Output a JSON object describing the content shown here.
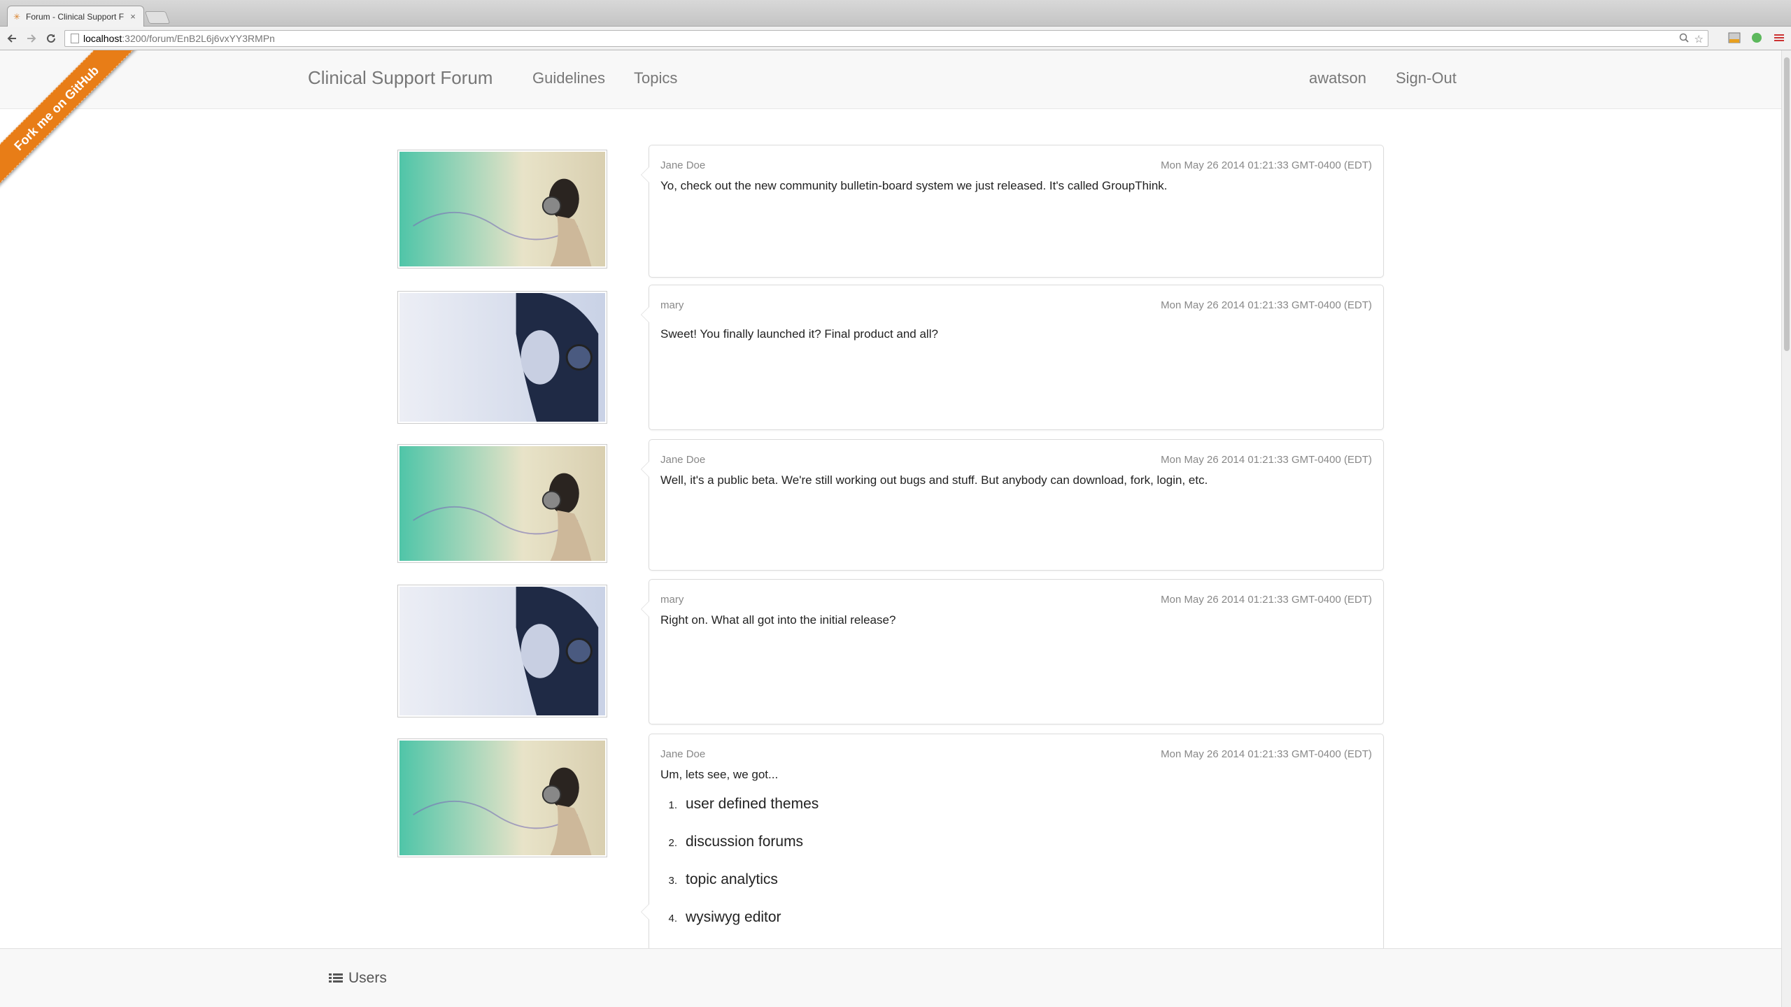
{
  "browser": {
    "tab_title": "Forum - Clinical Support F",
    "tab_close": "×",
    "url_host": "localhost",
    "url_path": ":3200/forum/EnB2L6j6vxYY3RMPn"
  },
  "ribbon": {
    "label": "Fork me on GitHub",
    "color": "#e87d17"
  },
  "navbar": {
    "brand": "Clinical Support Forum",
    "links": [
      "Guidelines",
      "Topics"
    ],
    "user": "awatson",
    "signout": "Sign-Out"
  },
  "posts": [
    {
      "author": "Jane Doe",
      "timestamp": "Mon May 26 2014 01:21:33 GMT-0400 (EDT)",
      "message": "Yo, check out the new community bulletin-board system we just released.  It's called GroupThink.",
      "avatar": "green-headphones-avatar"
    },
    {
      "author": "mary",
      "timestamp": "Mon May 26 2014 01:21:33 GMT-0400 (EDT)",
      "message": "Sweet!  You finally launched it?  Final product and all?",
      "avatar": "blue-headphones-avatar"
    },
    {
      "author": "Jane Doe",
      "timestamp": "Mon May 26 2014 01:21:33 GMT-0400 (EDT)",
      "message": "Well, it's a public beta.  We're still working out bugs and stuff.  But anybody can download, fork, login, etc.",
      "avatar": "green-headphones-avatar"
    },
    {
      "author": "mary",
      "timestamp": "Mon May 26 2014 01:21:33 GMT-0400 (EDT)",
      "message": "Right on.  What all got into the initial release?",
      "avatar": "blue-headphones-avatar"
    },
    {
      "author": "Jane Doe",
      "timestamp": "Mon May 26 2014 01:21:33 GMT-0400 (EDT)",
      "message": "Um, lets see, we got...",
      "avatar": "green-headphones-avatar",
      "list": [
        {
          "num": "1.",
          "text": "user defined themes"
        },
        {
          "num": "2.",
          "text": "discussion forums"
        },
        {
          "num": "3.",
          "text": "topic analytics"
        },
        {
          "num": "4.",
          "text": "wysiwyg editor"
        }
      ]
    }
  ],
  "footer": {
    "users_label": "Users"
  }
}
